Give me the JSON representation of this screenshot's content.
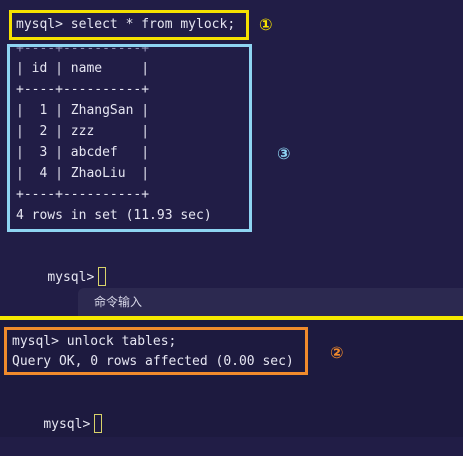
{
  "top_pane": {
    "command_line": "mysql> select * from mylock;",
    "table_lines": [
      "+----+----------+",
      "| id | name     |",
      "+----+----------+",
      "|  1 | ZhangSan |",
      "|  2 | zzz      |",
      "|  3 | abcdef   |",
      "|  4 | ZhaoLiu  |",
      "+----+----------+"
    ],
    "result_summary": "4 rows in set (11.93 sec)",
    "prompt": "mysql>"
  },
  "input_bar": {
    "placeholder": "命令输入"
  },
  "bottom_pane": {
    "command_line": "mysql> unlock tables;",
    "result_line": "Query OK, 0 rows affected (0.00 sec)",
    "prompt": "mysql>"
  },
  "markers": {
    "yellow": "①",
    "blue": "③",
    "orange": "②"
  },
  "colors": {
    "yellow": "#f5e100",
    "blue": "#8ed4f2",
    "orange": "#f18a2c",
    "background": "#211d46"
  }
}
